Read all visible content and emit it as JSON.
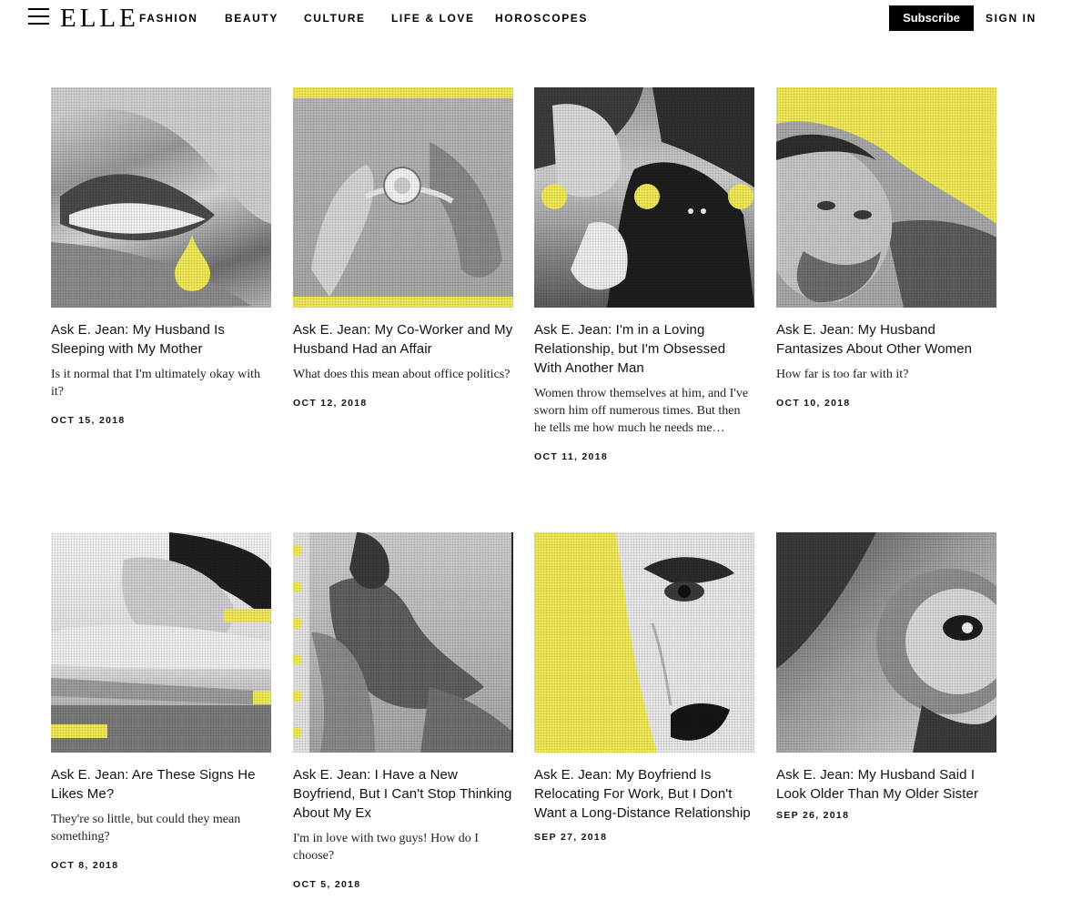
{
  "header": {
    "logo": "ELLE",
    "nav": [
      "FASHION",
      "BEAUTY",
      "CULTURE",
      "LIFE & LOVE",
      "HOROSCOPES"
    ],
    "subscribe_label": "Subscribe",
    "signin_label": "SIGN IN"
  },
  "colors": {
    "accent_yellow": "#f3ea57",
    "text": "#111111",
    "button_bg": "#000000"
  },
  "articles": [
    {
      "title": "Ask E. Jean: My Husband Is Sleeping with My Mother",
      "dek": "Is it normal that I'm ultimately okay with it?",
      "date": "OCT 15, 2018"
    },
    {
      "title": "Ask E. Jean: My Co-Worker and My Husband Had an Affair",
      "dek": "What does this mean about office politics?",
      "date": "OCT 12, 2018"
    },
    {
      "title": "Ask E. Jean: I'm in a Loving Relationship, but I'm Obsessed With Another Man",
      "dek": "Women throw themselves at him, and I've sworn him off numerous times. But then he tells me how much he needs me…",
      "date": "OCT 11, 2018"
    },
    {
      "title": "Ask E. Jean: My Husband Fantasizes About Other Women",
      "dek": "How far is too far with it?",
      "date": "OCT 10, 2018"
    },
    {
      "title": "Ask E. Jean: Are These Signs He Likes Me?",
      "dek": "They're so little, but could they mean something?",
      "date": "OCT 8, 2018"
    },
    {
      "title": "Ask E. Jean: I Have a New Boyfriend, But I Can't Stop Thinking About My Ex",
      "dek": "I'm in love with two guys! How do I choose?",
      "date": "OCT 5, 2018"
    },
    {
      "title": "Ask E. Jean: My Boyfriend Is Relocating For Work, But I Don't Want a Long-Distance Relationship",
      "dek": "",
      "date": "SEP 27, 2018"
    },
    {
      "title": "Ask E. Jean: My Husband Said I Look Older Than My Older Sister",
      "dek": "",
      "date": "SEP 26, 2018"
    }
  ]
}
